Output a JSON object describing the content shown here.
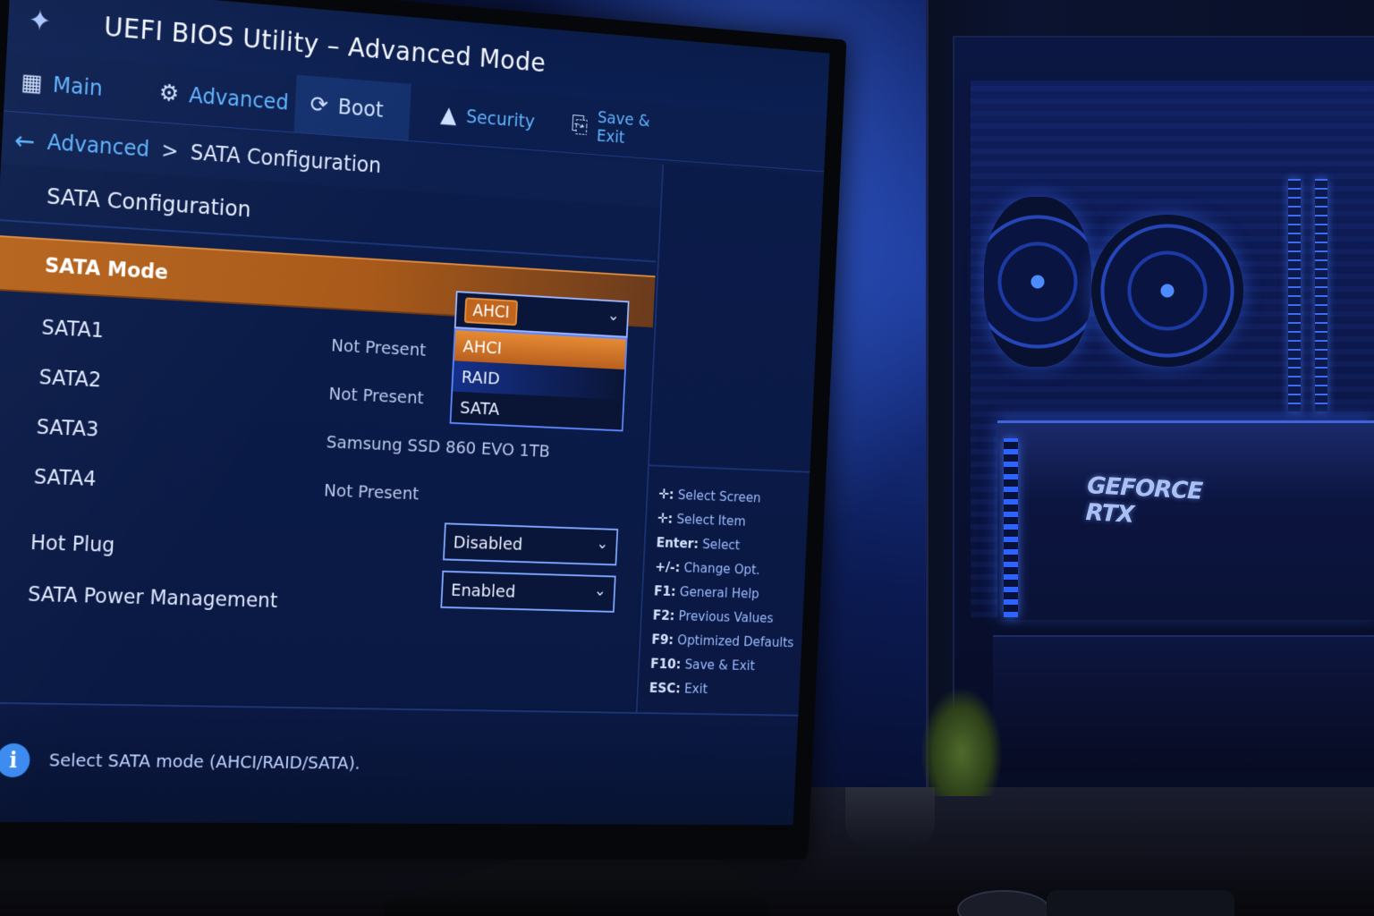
{
  "app": {
    "title": "UEFI BIOS Utility – Advanced Mode",
    "logo_icon": "bios-logo-icon"
  },
  "tabs": [
    {
      "label": "Main",
      "icon": "main-grid-icon",
      "glyph": "▦",
      "active": false
    },
    {
      "label": "Advanced",
      "icon": "advanced-nodes-icon",
      "glyph": "⚙",
      "active": false
    },
    {
      "label": "Boot",
      "icon": "boot-power-icon",
      "glyph": "⟳",
      "active": true
    },
    {
      "label": "Security",
      "icon": "lock-icon",
      "glyph": "🔒",
      "active": false
    },
    {
      "label": "Save & Exit",
      "icon": "save-exit-icon",
      "glyph": "⎘",
      "active": false
    }
  ],
  "breadcrumb": {
    "back_glyph": "←",
    "parent": "Advanced",
    "separator": ">",
    "current": "SATA Configuration"
  },
  "section": {
    "title": "SATA Configuration"
  },
  "sata_mode": {
    "label": "SATA Mode",
    "value": "AHCI",
    "chevron": "⌄",
    "options": [
      "AHCI",
      "RAID",
      "SATA"
    ]
  },
  "ports": [
    {
      "label": "SATA1",
      "value": "Not Present"
    },
    {
      "label": "SATA2",
      "value": "Not Present"
    },
    {
      "label": "SATA3",
      "value": "Samsung SSD 860 EVO 1TB"
    },
    {
      "label": "SATA4",
      "value": "Not Present"
    }
  ],
  "hot_plug": {
    "label": "Hot Plug",
    "value": "Disabled",
    "chevron": "⌄"
  },
  "power_mgmt": {
    "label": "SATA Power Management",
    "value": "Enabled",
    "chevron": "⌄"
  },
  "help_keys": [
    {
      "key": "✛:",
      "text": "Select Screen"
    },
    {
      "key": "✛:",
      "text": "Select Item"
    },
    {
      "key": "Enter:",
      "text": "Select"
    },
    {
      "key": "+/-:",
      "text": "Change Opt."
    },
    {
      "key": "F1:",
      "text": "General Help"
    },
    {
      "key": "F2:",
      "text": "Previous Values"
    },
    {
      "key": "F9:",
      "text": "Optimized Defaults"
    },
    {
      "key": "F10:",
      "text": "Save & Exit"
    },
    {
      "key": "ESC:",
      "text": "Exit"
    }
  ],
  "status": {
    "icon": "info-icon",
    "glyph": "i",
    "text": "Select SATA mode (AHCI/RAID/SATA)."
  },
  "background": {
    "gpu_label": "GEFORCE RTX"
  },
  "colors": {
    "accent_orange": "#b6631c",
    "tab_blue": "#5fb3ff",
    "screen_bg": "#0a1a44"
  }
}
